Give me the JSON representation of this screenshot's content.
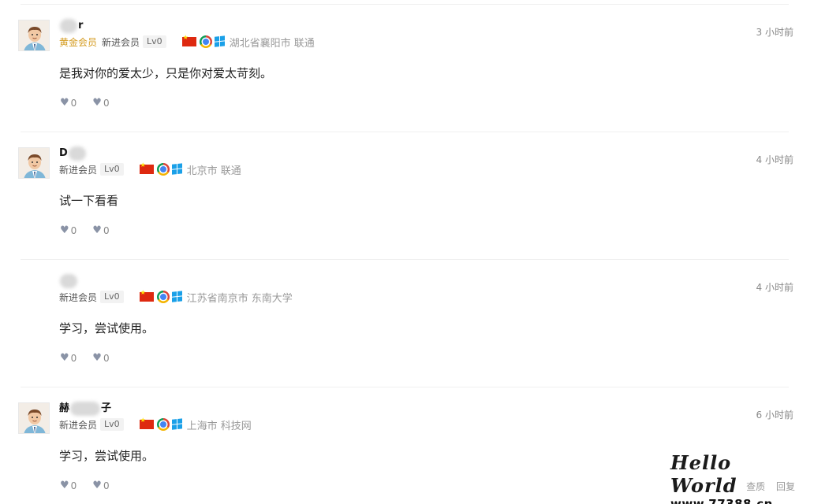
{
  "comments": [
    {
      "name_visible": "r",
      "vip": "黄金会员",
      "member": "新进会员",
      "level": "Lv0",
      "location": "湖北省襄阳市 联通",
      "time": "3 小时前",
      "content": "是我对你的爱太少，只是你对爱太苛刻。",
      "likes": "0",
      "dislikes": "0"
    },
    {
      "name_visible": "D",
      "member": "新进会员",
      "level": "Lv0",
      "location": "北京市 联通",
      "time": "4 小时前",
      "content": "试一下看看",
      "likes": "0",
      "dislikes": "0"
    },
    {
      "name_visible": "",
      "member": "新进会员",
      "level": "Lv0",
      "location": "江苏省南京市 东南大学",
      "time": "4 小时前",
      "content": "学习，尝试使用。",
      "likes": "0",
      "dislikes": "0"
    },
    {
      "name_visible_prefix": "赫",
      "name_visible_suffix": "子",
      "member": "新进会员",
      "level": "Lv0",
      "location": "上海市 科技网",
      "time": "6 小时前",
      "content": "学习，尝试使用。",
      "likes": "0",
      "dislikes": "0"
    }
  ],
  "footer_actions": {
    "view": "查质",
    "reply": "回复"
  },
  "watermark": {
    "title": "Hello World",
    "url": "www.77388.cn"
  },
  "colors": {
    "vip": "#d49b1f",
    "icon": "#8a93a6",
    "muted": "#999999"
  },
  "icons": [
    "avatar-icon",
    "china-flag-icon",
    "chrome-icon",
    "windows-icon",
    "heart-icon",
    "broken-heart-icon"
  ]
}
